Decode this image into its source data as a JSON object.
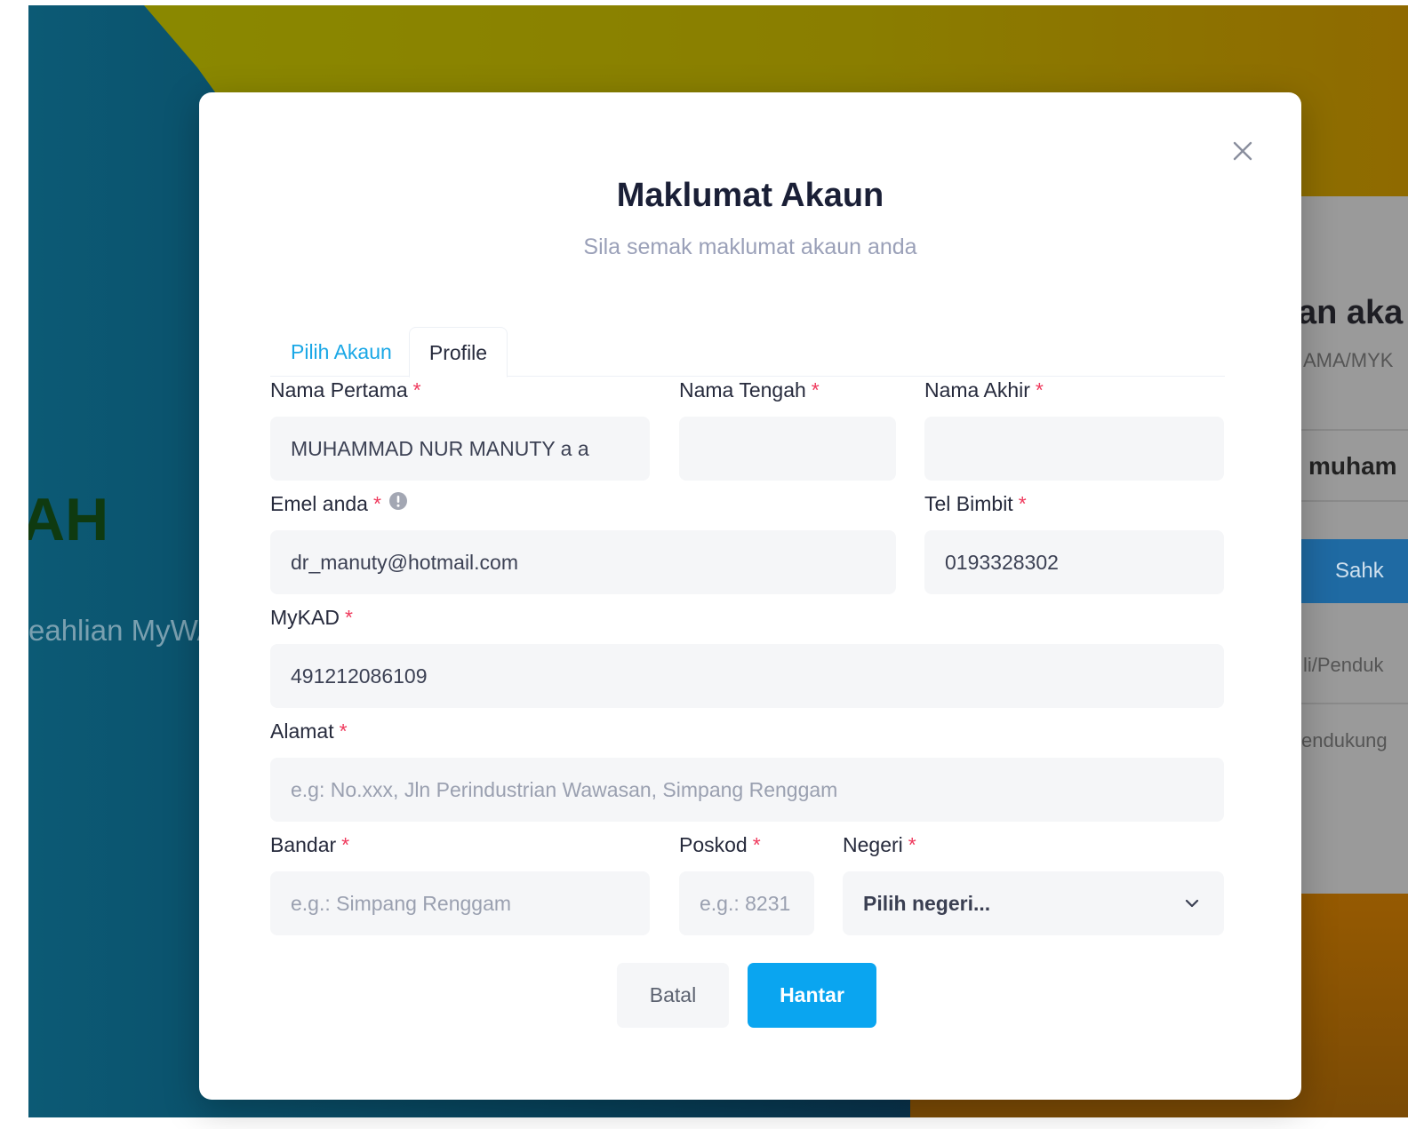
{
  "background": {
    "heading_fragment": "AH",
    "subtext_fragment": "eahlian MyWA",
    "side_card": {
      "title_fragment": "an aka",
      "label_fragment": "AMA/MYK",
      "value_fragment": "muham",
      "button_fragment": "Sahk",
      "link_fragment_1": "li/Penduk",
      "link_fragment_2": "endukung"
    }
  },
  "modal": {
    "title": "Maklumat Akaun",
    "subtitle": "Sila semak maklumat akaun anda",
    "close_icon": "close-icon",
    "tabs": [
      {
        "label": "Pilih Akaun",
        "active": false
      },
      {
        "label": "Profile",
        "active": true
      }
    ],
    "required_marker": "*",
    "fields": {
      "nama_pertama": {
        "label": "Nama Pertama",
        "value": "MUHAMMAD NUR MANUTY a a"
      },
      "nama_tengah": {
        "label": "Nama Tengah",
        "value": ""
      },
      "nama_akhir": {
        "label": "Nama Akhir",
        "value": ""
      },
      "emel": {
        "label": "Emel anda",
        "value": "dr_manuty@hotmail.com",
        "icon": "info-icon"
      },
      "tel": {
        "label": "Tel Bimbit",
        "value": "0193328302"
      },
      "mykad": {
        "label": "MyKAD",
        "value": "491212086109"
      },
      "alamat": {
        "label": "Alamat",
        "value": "",
        "placeholder": "e.g: No.xxx, Jln Perindustrian Wawasan, Simpang Renggam"
      },
      "bandar": {
        "label": "Bandar",
        "value": "",
        "placeholder": "e.g.: Simpang Renggam"
      },
      "poskod": {
        "label": "Poskod",
        "value": "",
        "placeholder": "e.g.: 8231"
      },
      "negeri": {
        "label": "Negeri",
        "selected": "Pilih negeri...",
        "icon": "chevron-down-icon"
      }
    },
    "buttons": {
      "cancel": "Batal",
      "submit": "Hantar"
    }
  },
  "colors": {
    "accent": "#0aa5f0",
    "tab_active_link": "#19a7e6",
    "required": "#ef3a5d",
    "input_bg": "#f5f6f8"
  }
}
